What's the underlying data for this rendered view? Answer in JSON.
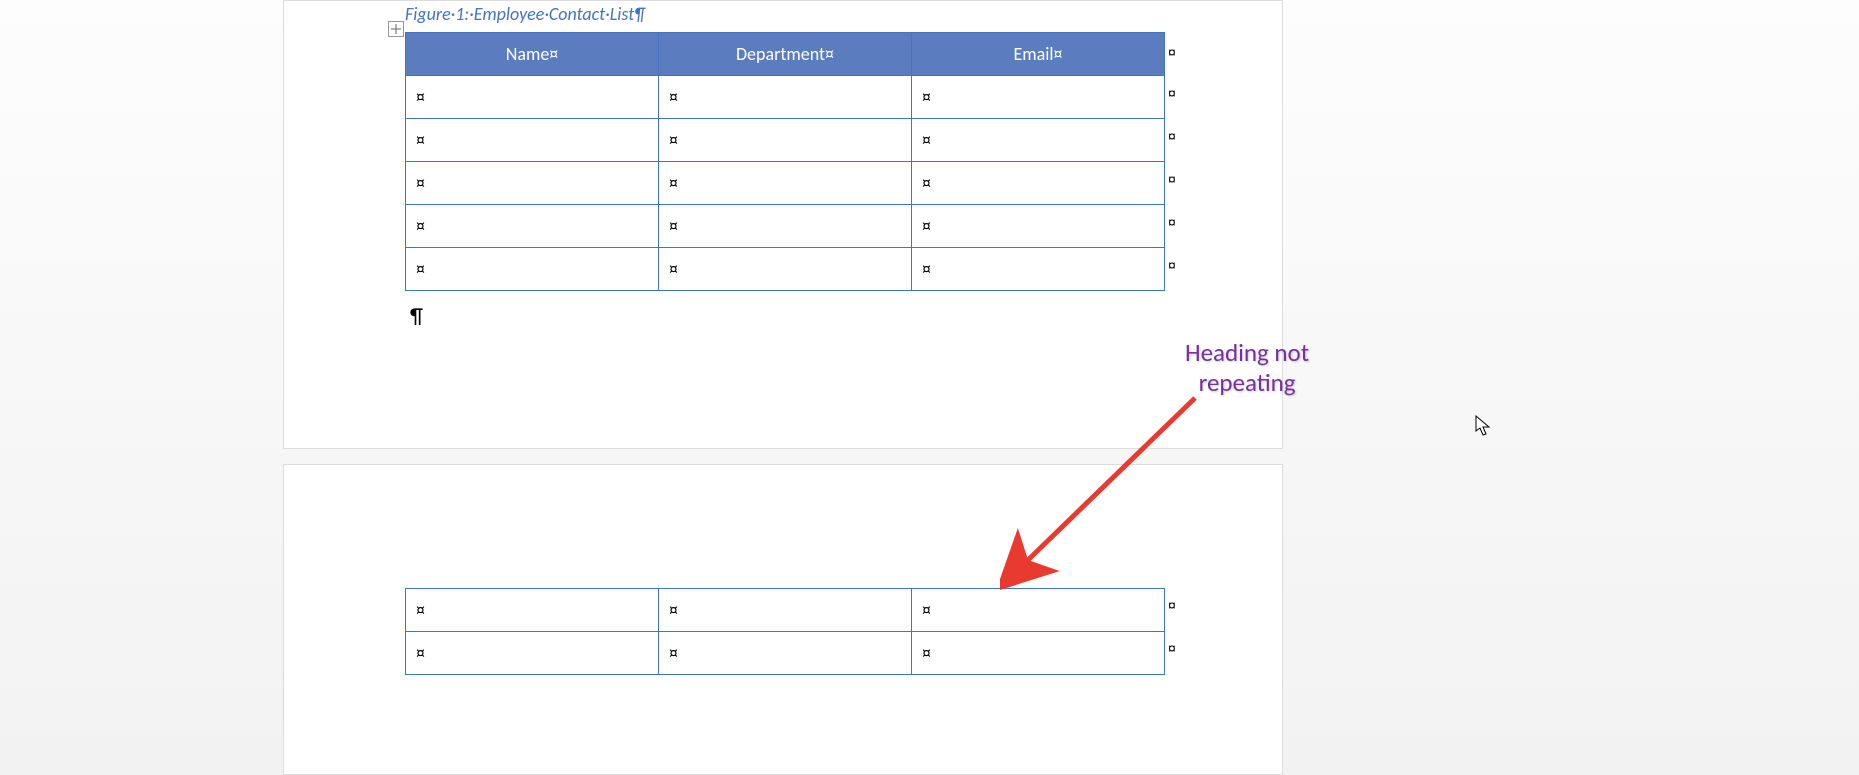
{
  "caption": "Figure·1:·Employee·Contact·List¶",
  "table": {
    "headers": [
      "Name¤",
      "Department¤",
      "Email¤"
    ],
    "cell_mark": "¤",
    "row_end_mark": "¤",
    "page1_rows": 5,
    "page2_rows": 2
  },
  "paragraph_mark": "¶",
  "annotation": {
    "line1": "Heading not",
    "line2": "repeating"
  },
  "anchor_symbol": "✥"
}
